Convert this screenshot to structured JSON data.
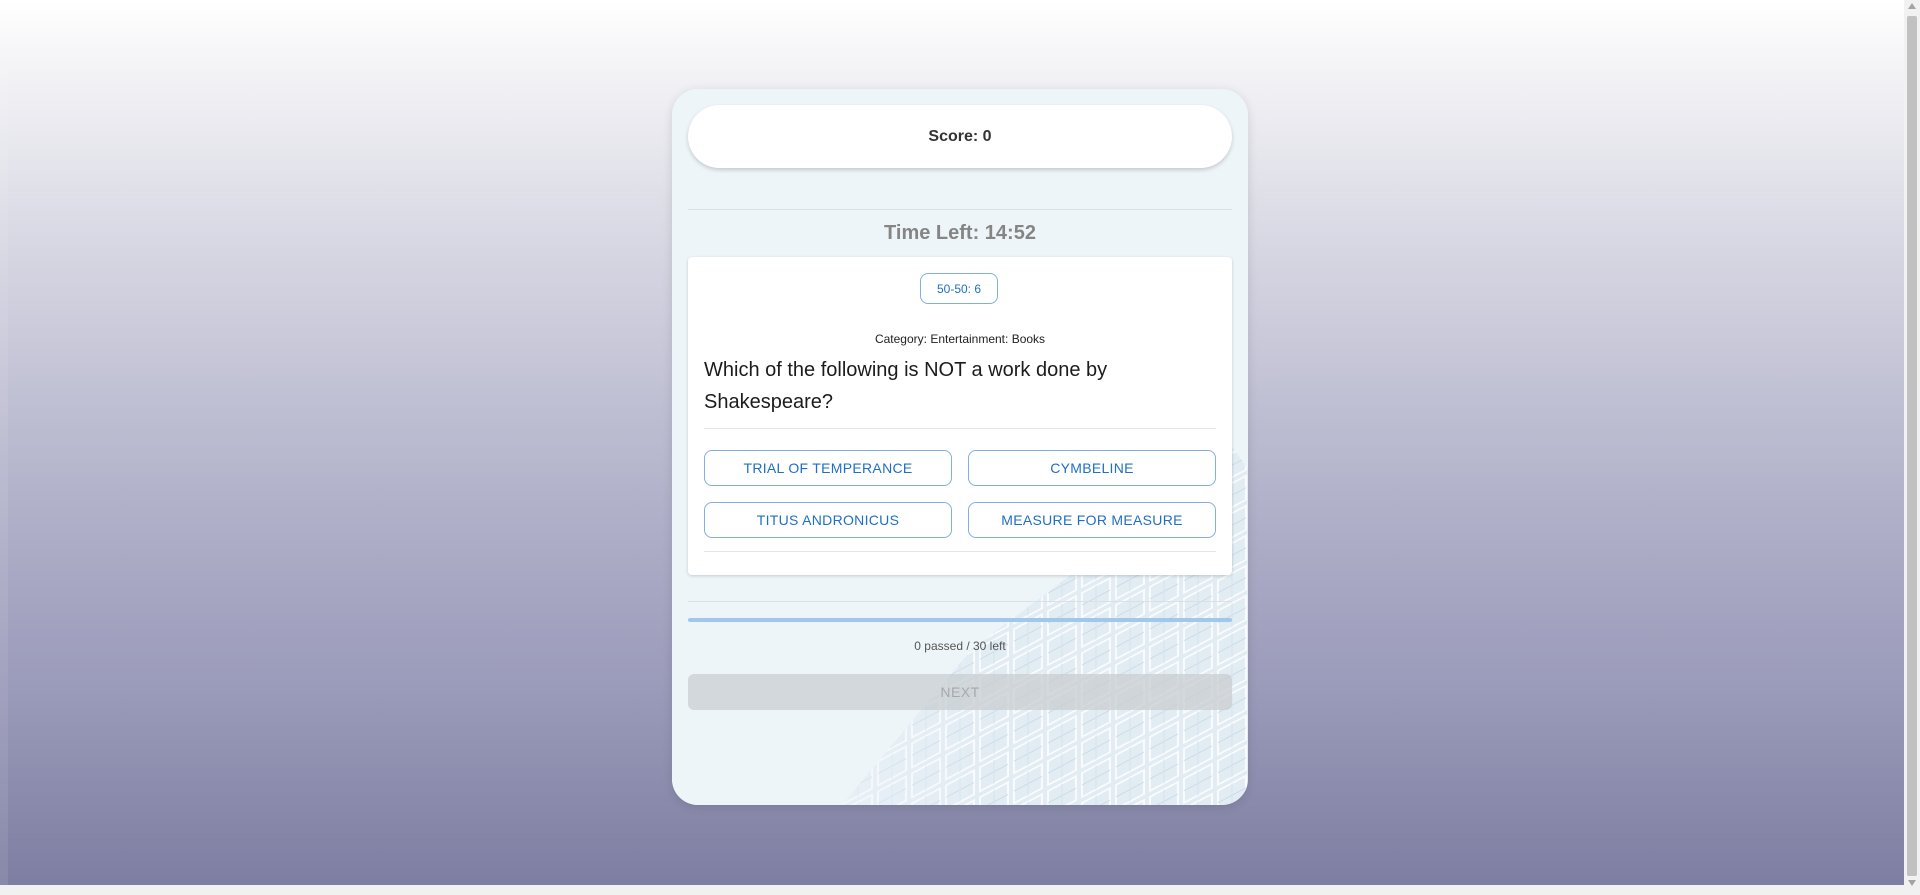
{
  "quiz": {
    "score_label": "Score: 0",
    "timer_label": "Time Left: 14:52",
    "lifeline_label": "50-50: 6",
    "category_label": "Category: Entertainment: Books",
    "question": "Which of the following is NOT a work done by Shakespeare?",
    "answers": [
      "TRIAL OF TEMPERANCE",
      "CYMBELINE",
      "TITUS ANDRONICUS",
      "MEASURE FOR MEASURE"
    ],
    "progress_fraction": 0,
    "progress_label": "0 passed / 30 left",
    "next_label": "NEXT"
  },
  "colors": {
    "accent": "#1f6fc4",
    "answer_border": "#7fb0e0",
    "progress_track": "#a3c7ec",
    "card_bg": "#eef5f9"
  }
}
